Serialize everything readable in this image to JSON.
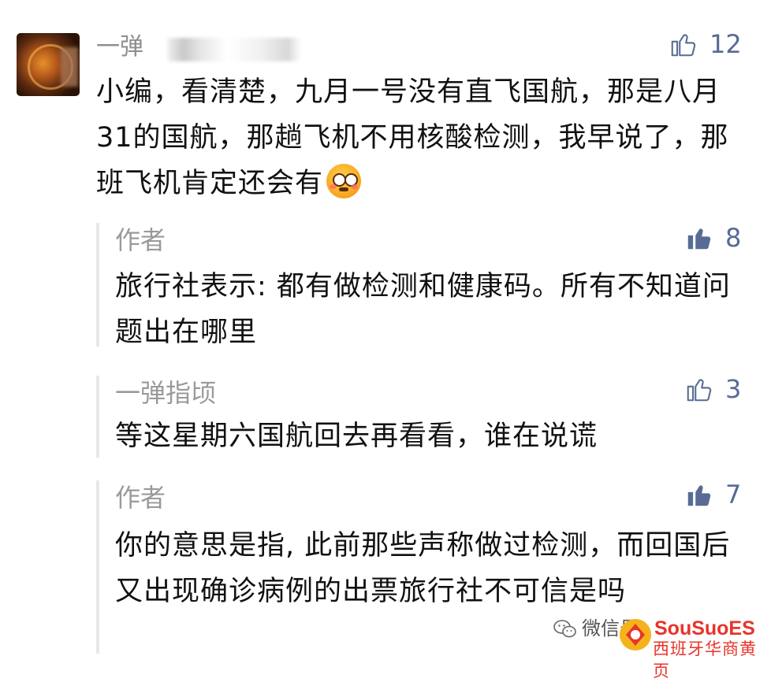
{
  "main_comment": {
    "author": "一弹",
    "likes": "12",
    "text": "小编，看清楚，九月一号没有直飞国航，那是八月31的国航，那趟飞机不用核酸检测，我早说了，那班飞机肯定还会有",
    "emoji": "flushed-face-emoji"
  },
  "replies": [
    {
      "author": "作者",
      "likes": "8",
      "liked": true,
      "text": "旅行社表示: 都有做检测和健康码。所有不知道问题出在哪里"
    },
    {
      "author": "一弹指顷",
      "likes": "3",
      "liked": false,
      "text": "等这星期六国航回去再看看，谁在说谎"
    },
    {
      "author": "作者",
      "likes": "7",
      "liked": true,
      "text": "你的意思是指, 此前那些声称做过检测，而回国后又出现确诊病例的出票旅行社不可信是吗"
    }
  ],
  "watermark": {
    "wechat_label": "微信号:",
    "brand": "SouSuoES",
    "brand_sub": "西班牙华商黄页"
  },
  "colors": {
    "link": "#576b95",
    "muted": "#9a9a9a",
    "text": "#111111",
    "brand": "#e8342b"
  }
}
